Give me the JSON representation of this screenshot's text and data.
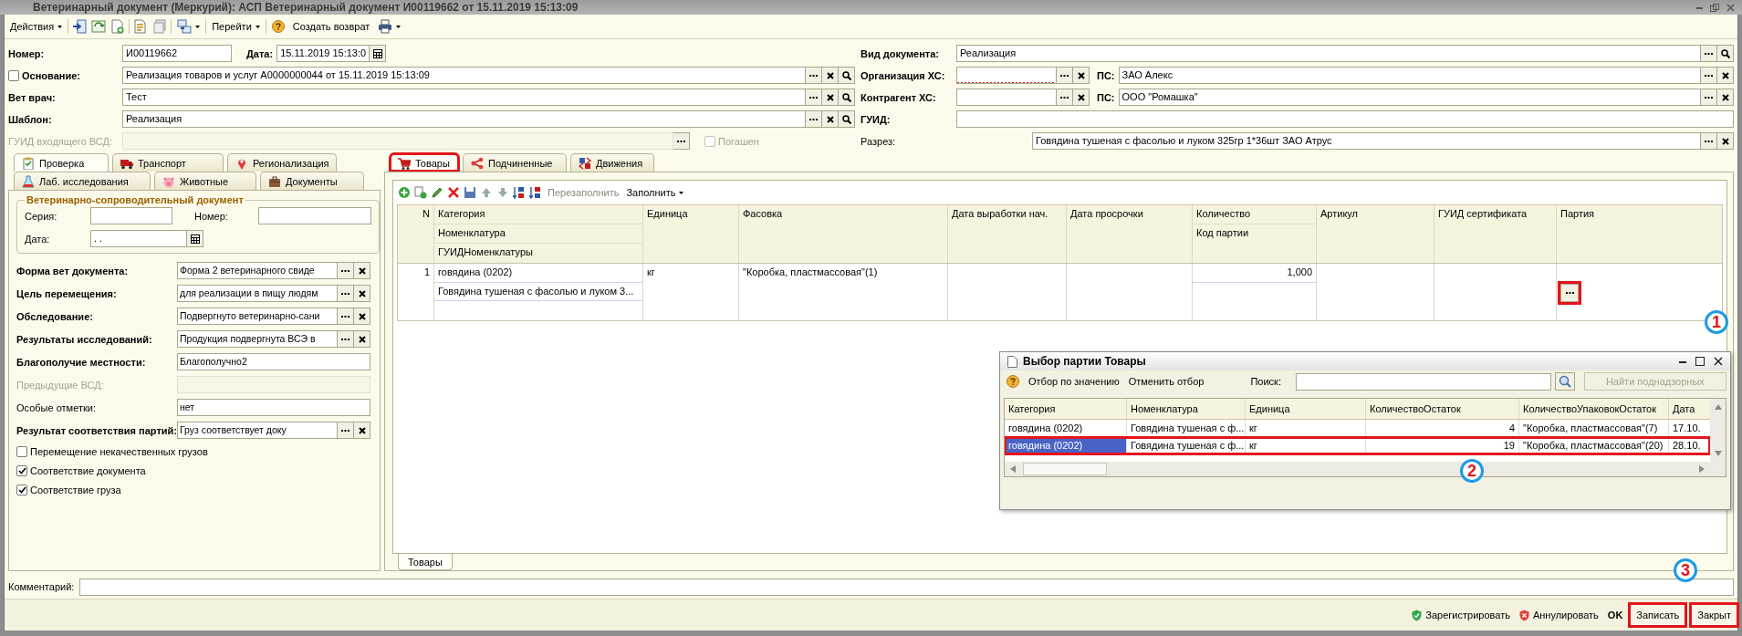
{
  "window": {
    "title": "Ветеринарный документ (Меркурий): АСП Ветеринарный документ И00119662 от 15.11.2019 15:13:09"
  },
  "toolbar": {
    "actions": "Действия",
    "go_to": "Перейти",
    "create_return": "Создать возврат"
  },
  "header": {
    "number": {
      "label": "Номер:",
      "value": "И00119662"
    },
    "date": {
      "label": "Дата:",
      "value": "15.11.2019 15:13:0"
    },
    "basis": {
      "label": "Основание:",
      "checked": false,
      "value": "Реализация товаров и услуг А0000000044 от 15.11.2019 15:13:09"
    },
    "vet": {
      "label": "Вет врач:",
      "value": "Тест"
    },
    "template": {
      "label": "Шаблон:",
      "value": "Реализация"
    },
    "incoming_guid": {
      "label": "ГУИД входящего ВСД:",
      "disabled": true
    },
    "repaid": {
      "label": "Погашен",
      "checked": false,
      "disabled": true
    },
    "doc_type": {
      "label": "Вид документа:",
      "value": "Реализация"
    },
    "organization": {
      "label": "Организация ХС:",
      "required": true,
      "ps_label": "ПС:",
      "ps_value": "ЗАО Алекс"
    },
    "counterparty": {
      "label": "Контрагент ХС:",
      "required": false,
      "ps_label": "ПС:",
      "ps_value": "ООО \"Ромашка\""
    },
    "guid": {
      "label": "ГУИД:"
    },
    "section": {
      "label": "Разрез:",
      "value": "Говядина тушеная с фасолью и луком 325гр  1*36шт ЗАО Атрус"
    }
  },
  "left_tabs": [
    {
      "label": "Проверка",
      "selected": true
    },
    {
      "label": "Транспорт",
      "selected": false
    },
    {
      "label": "Регионализация",
      "selected": false
    },
    {
      "label": "Лаб. исследования",
      "selected": false
    },
    {
      "label": "Животные",
      "selected": false
    },
    {
      "label": "Документы",
      "selected": false
    }
  ],
  "vsd_group": {
    "title": "Ветеринарно-сопроводительный документ",
    "series_label": "Серия:",
    "number_label": "Номер:",
    "date_label": "Дата:",
    "date_value": " .  ."
  },
  "left_form": [
    {
      "kind": "select",
      "label": "Форма вет документа:",
      "value": "Форма 2 ветеринарного свиде"
    },
    {
      "kind": "select",
      "label": "Цель перемещения:",
      "value": "для реализации в пищу людям"
    },
    {
      "kind": "select",
      "label": "Обследование:",
      "value": "Подвергнуто ветеринарно-сани"
    },
    {
      "kind": "select",
      "label": "Результаты исследований:",
      "value": "Продукция подвергнута ВСЭ в"
    },
    {
      "kind": "input",
      "label": "Благополучие местности:",
      "value": "Благополучно2"
    },
    {
      "kind": "inactive",
      "label": "Предыдущие ВСД:"
    },
    {
      "kind": "note",
      "label": "Особые отметки:",
      "value": "нет"
    },
    {
      "kind": "select",
      "label": "Результат соответствия партий:",
      "value": "Груз соответствует доку"
    }
  ],
  "checkboxes": [
    {
      "label": "Перемещение некачественных грузов",
      "checked": false
    },
    {
      "label": "Соответствие документа",
      "checked": true
    },
    {
      "label": "Соответствие груза",
      "checked": true
    }
  ],
  "right_tabs": [
    {
      "label": "Товары",
      "selected": true,
      "highlighted": true
    },
    {
      "label": "Подчиненные",
      "selected": false,
      "highlighted": false
    },
    {
      "label": "Движения",
      "selected": false,
      "highlighted": false
    }
  ],
  "goods_toolbar": {
    "refill": "Перезаполнить",
    "fill": "Заполнить"
  },
  "goods_table": {
    "columns": [
      {
        "lines": [
          "N"
        ]
      },
      {
        "lines": [
          "Категория",
          "Номенклатура",
          "ГУИДНоменклатуры"
        ]
      },
      {
        "lines": [
          "Единица"
        ]
      },
      {
        "lines": [
          "Фасовка"
        ]
      },
      {
        "lines": [
          "Дата выработки нач."
        ]
      },
      {
        "lines": [
          "Дата просрочки"
        ]
      },
      {
        "lines": [
          "Количество",
          "Код партии"
        ]
      },
      {
        "lines": [
          "Артикул"
        ]
      },
      {
        "lines": [
          "ГУИД сертификата"
        ]
      },
      {
        "lines": [
          "Партия"
        ]
      }
    ],
    "rows": [
      {
        "cells": [
          [
            "1"
          ],
          [
            "говядина (0202)",
            "Говядина тушеная с фасолью и луком 3..."
          ],
          [
            "кг"
          ],
          [
            "\"Коробка, пластмассовая\"(1)"
          ],
          [
            null
          ],
          [
            null
          ],
          [
            "1,000"
          ],
          [
            null
          ],
          [
            null
          ],
          [
            null
          ]
        ],
        "select_highlighted": true
      }
    ]
  },
  "bottom_tab": {
    "label": "Товары",
    "selected": true
  },
  "popup": {
    "title": "Выбор партии Товары",
    "filter": "Отбор по значению",
    "cancel_filter": "Отменить отбор",
    "search_label": "Поиск:",
    "find_button": "Найти поднадзорных",
    "columns": [
      "Категория",
      "Номенклатура",
      "Единица",
      "КоличествоОстаток",
      "КоличествоУпаковокОстаток",
      "Дата"
    ],
    "rows": [
      {
        "cells": [
          "говядина (0202)",
          "Говядина тушеная с ф...",
          "кг",
          "4",
          "\"Коробка, пластмассовая\"(7)",
          "17.10."
        ],
        "selected": false,
        "highlighted": false
      },
      {
        "cells": [
          "говядина (0202)",
          "Говядина тушеная с ф...",
          "кг",
          "19",
          "\"Коробка, пластмассовая\"(20)",
          "28.10."
        ],
        "selected": true,
        "highlighted": true
      }
    ]
  },
  "comment": {
    "label": "Комментарий:"
  },
  "status_bar": [
    {
      "kind": "register",
      "label": "Зарегистрировать",
      "highlighted": false
    },
    {
      "kind": "annul",
      "label": "Аннулировать",
      "highlighted": false
    },
    {
      "kind": "ok",
      "label": "OK",
      "highlighted": false
    },
    {
      "kind": "button",
      "label": "Записать",
      "highlighted": true
    },
    {
      "kind": "button",
      "label": "Закрыт",
      "highlighted": true
    }
  ],
  "callouts": [
    {
      "label": "1"
    },
    {
      "label": "2"
    },
    {
      "label": "3"
    }
  ]
}
